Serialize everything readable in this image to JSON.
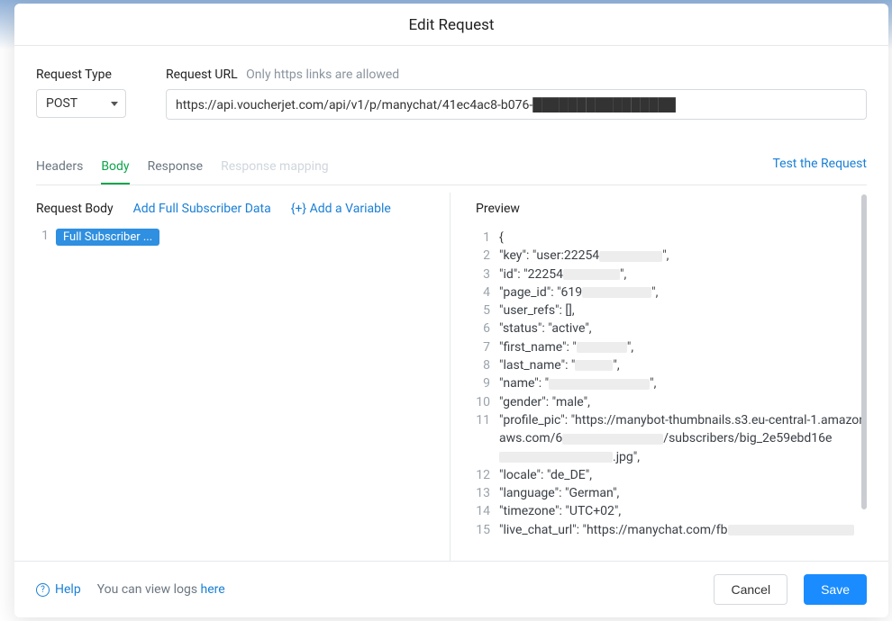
{
  "modal": {
    "title": "Edit Request"
  },
  "fields": {
    "request_type_label": "Request Type",
    "request_url_label": "Request URL",
    "request_url_hint": "Only https links are allowed",
    "request_type_value": "POST",
    "request_url_value": "https://api.voucherjet.com/api/v1/p/manychat/41ec4ac8-b076-████████████████"
  },
  "tabs": {
    "headers": "Headers",
    "body": "Body",
    "response": "Response",
    "response_mapping": "Response mapping",
    "test": "Test the Request"
  },
  "body_panel": {
    "title": "Request Body",
    "add_subscriber": "Add Full Subscriber Data",
    "add_variable": "{+} Add a Variable",
    "line1_num": "1",
    "pill": "Full Subscriber ..."
  },
  "preview_panel": {
    "title": "Preview",
    "lines": [
      {
        "n": "1",
        "t": "{"
      },
      {
        "n": "2",
        "t": "  \"key\": \"user:22254██████████\","
      },
      {
        "n": "3",
        "t": "  \"id\": \"22254█████████\","
      },
      {
        "n": "4",
        "t": "  \"page_id\": \"619███████████\","
      },
      {
        "n": "5",
        "t": "  \"user_refs\": [],"
      },
      {
        "n": "6",
        "t": "  \"status\": \"active\","
      },
      {
        "n": "7",
        "t": "  \"first_name\": \"████████\","
      },
      {
        "n": "8",
        "t": "  \"last_name\": \"██████\","
      },
      {
        "n": "9",
        "t": "  \"name\": \"████████████████\","
      },
      {
        "n": "10",
        "t": "  \"gender\": \"male\","
      },
      {
        "n": "11",
        "t": "  \"profile_pic\": \"https://manybot-thumbnails.s3.eu-central-1.amazonaws.com/6████████████████/subscribers/big_2e59ebd16e██████████████████.jpg\","
      },
      {
        "n": "12",
        "t": "  \"locale\": \"de_DE\","
      },
      {
        "n": "13",
        "t": "  \"language\": \"German\","
      },
      {
        "n": "14",
        "t": "  \"timezone\": \"UTC+02\","
      },
      {
        "n": "15",
        "t": "  \"live_chat_url\": \"https://manychat.com/fb████████████████████"
      }
    ]
  },
  "footer": {
    "help": "Help",
    "logs_text": "You can view logs ",
    "logs_link": "here",
    "cancel": "Cancel",
    "save": "Save"
  }
}
